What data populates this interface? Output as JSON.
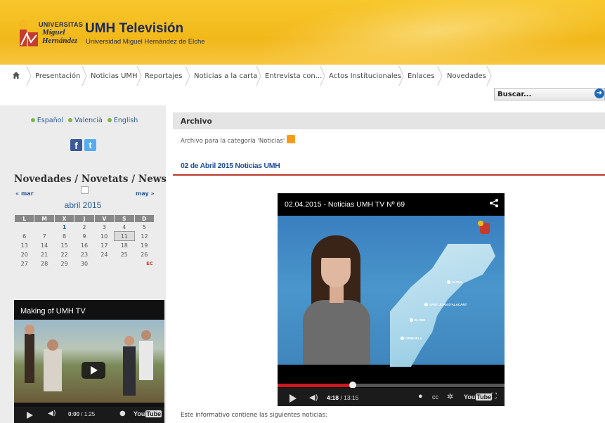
{
  "header": {
    "logo": {
      "line1": "UNIVERSITAS",
      "line2": "Miguel",
      "line3": "Hernández"
    },
    "title": "UMH Televisión",
    "subtitle": "Universidad Miguel Hernández de Elche"
  },
  "nav": {
    "items": [
      "Presentación",
      "Noticias UMH",
      "Reportajes",
      "Noticias a la carta",
      "Entrevista con...",
      "Actos Institucionales",
      "Enlaces",
      "Novedades"
    ]
  },
  "search": {
    "value": "Buscar..."
  },
  "sidebar": {
    "languages": [
      "Español",
      "Valencià",
      "English"
    ],
    "novedades_title": "Novedades / Novetats / News",
    "calendar": {
      "prev": "« mar",
      "next": "may »",
      "month": "abril 2015",
      "weekdays": [
        "L",
        "M",
        "X",
        "J",
        "V",
        "S",
        "D"
      ],
      "rows": [
        [
          "",
          "",
          "1",
          "2",
          "3",
          "4",
          "5"
        ],
        [
          "6",
          "7",
          "8",
          "9",
          "10",
          "11",
          "12"
        ],
        [
          "13",
          "14",
          "15",
          "16",
          "17",
          "18",
          "19"
        ],
        [
          "20",
          "21",
          "22",
          "23",
          "24",
          "25",
          "26"
        ],
        [
          "27",
          "28",
          "29",
          "30",
          "",
          "",
          "EC"
        ]
      ],
      "today": "11",
      "linked": [
        "1"
      ]
    },
    "video": {
      "title": "Making of UMH TV",
      "time_current": "0:00",
      "time_total": "1:25"
    }
  },
  "main": {
    "heading": "Archivo",
    "category_line": "Archivo para la categoría 'Noticias'",
    "post_title": "02 de Abril 2015 Noticias UMH",
    "video": {
      "title": "02.04.2015 - Noticias UMH TV Nº 69",
      "time_current": "4:18",
      "time_total": "13:15",
      "progress": 0.33,
      "cities": [
        "ALTEA",
        "SANT JOAN D'ALACANT",
        "ELCHE",
        "ORIHUELA"
      ]
    },
    "intro": "Este informativo contiene las siguientes noticias:"
  },
  "colors": {
    "header": "#f2b81a",
    "link": "#2a5a9a",
    "post_line": "#c0392b",
    "progress": "#cc181e"
  }
}
